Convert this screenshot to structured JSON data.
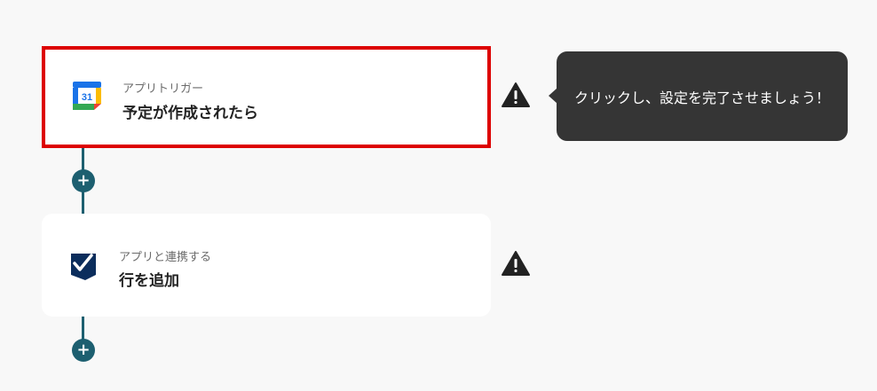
{
  "flow": {
    "steps": [
      {
        "kind": "アプリトリガー",
        "title": "予定が作成されたら",
        "icon": "google-calendar-icon",
        "calendar_day": "31",
        "selected": true,
        "status_icon": "warning-icon"
      },
      {
        "kind": "アプリと連携する",
        "title": "行を追加",
        "icon": "smartsheet-icon",
        "selected": false,
        "status_icon": "warning-icon"
      }
    ],
    "add_step_label": "+"
  },
  "tooltip": {
    "text": "クリックし、設定を完了させましょう！"
  },
  "colors": {
    "background": "#f8f8f8",
    "connector": "#1d5f70",
    "selected_border": "#dd0000",
    "tooltip_bg": "#353535"
  }
}
